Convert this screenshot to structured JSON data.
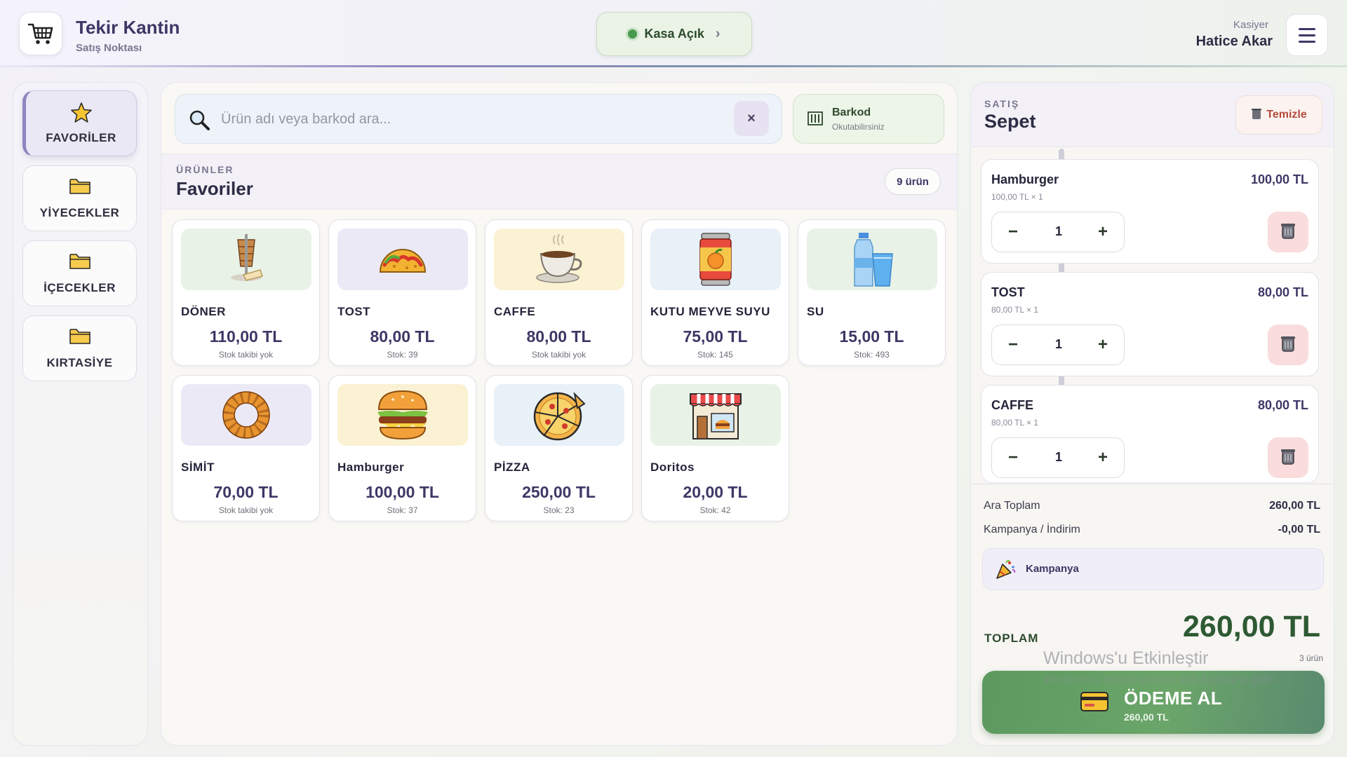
{
  "header": {
    "app_title": "Tekir Kantin",
    "app_subtitle": "Satış Noktası",
    "status_label": "Kasa Açık",
    "cashier_role": "Kasiyer",
    "cashier_name": "Hatice Akar"
  },
  "sidebar": {
    "items": [
      {
        "label": "FAVORİLER",
        "icon": "star-icon",
        "active": true
      },
      {
        "label": "YİYECEKLER",
        "icon": "folder-icon",
        "active": false
      },
      {
        "label": "İÇECEKLER",
        "icon": "folder-icon",
        "active": false
      },
      {
        "label": "KIRTASİYE",
        "icon": "folder-icon",
        "active": false
      }
    ]
  },
  "search": {
    "placeholder": "Ürün adı veya barkod ara...",
    "value": "",
    "clear_label": "×"
  },
  "barcode": {
    "title": "Barkod",
    "subtitle": "Okutabilirsiniz"
  },
  "products_section": {
    "kicker": "ÜRÜNLER",
    "title": "Favoriler",
    "count": "9 ürün"
  },
  "products": [
    {
      "name": "DÖNER",
      "price": "110,00 TL",
      "stock": "Stok takibi yok",
      "icon": "doner-icon",
      "bg": "#e9f2e7"
    },
    {
      "name": "TOST",
      "price": "80,00 TL",
      "stock": "Stok: 39",
      "icon": "taco-icon",
      "bg": "#ece9f6"
    },
    {
      "name": "CAFFE",
      "price": "80,00 TL",
      "stock": "Stok takibi yok",
      "icon": "coffee-cup-icon",
      "bg": "#fbf1d3"
    },
    {
      "name": "KUTU MEYVE SUYU",
      "price": "75,00 TL",
      "stock": "Stok: 145",
      "icon": "juice-can-icon",
      "bg": "#e8f0f8"
    },
    {
      "name": "SU",
      "price": "15,00 TL",
      "stock": "Stok: 493",
      "icon": "water-bottle-icon",
      "bg": "#e9f2e7"
    },
    {
      "name": "SİMİT",
      "price": "70,00 TL",
      "stock": "Stok takibi yok",
      "icon": "simit-icon",
      "bg": "#ece9f6"
    },
    {
      "name": "Hamburger",
      "price": "100,00 TL",
      "stock": "Stok: 37",
      "icon": "hamburger-icon",
      "bg": "#fbf1d3"
    },
    {
      "name": "PİZZA",
      "price": "250,00 TL",
      "stock": "Stok: 23",
      "icon": "pizza-icon",
      "bg": "#e8f0f8"
    },
    {
      "name": "Doritos",
      "price": "20,00 TL",
      "stock": "Stok: 42",
      "icon": "shop-icon",
      "bg": "#e9f2e7"
    }
  ],
  "cart": {
    "kicker": "SATIŞ",
    "title": "Sepet",
    "clear_label": "Temizle",
    "items": [
      {
        "name": "Hamburger",
        "total": "100,00 TL",
        "unit": "100,00 TL × 1",
        "qty": "1"
      },
      {
        "name": "TOST",
        "total": "80,00 TL",
        "unit": "80,00 TL × 1",
        "qty": "1"
      },
      {
        "name": "CAFFE",
        "total": "80,00 TL",
        "unit": "80,00 TL × 1",
        "qty": "1"
      }
    ],
    "subtotal_label": "Ara Toplam",
    "subtotal_value": "260,00 TL",
    "discount_label": "Kampanya / İndirim",
    "discount_value": "-0,00 TL",
    "campaign_label": "Kampanya",
    "total_label": "TOPLAM",
    "total_value": "260,00 TL",
    "total_count": "3 ürün",
    "pay_label": "ÖDEME AL",
    "pay_amount": "260,00 TL"
  },
  "watermark": {
    "line1": "Windows'u Etkinleştir",
    "line2": "Windows'u etkinleştirmek için Ayarlar'a gidin."
  },
  "colors": {
    "accent": "#3e3766",
    "success": "#4a9a4e",
    "danger": "#b54a3c",
    "pay_button": "#6ba56a"
  }
}
